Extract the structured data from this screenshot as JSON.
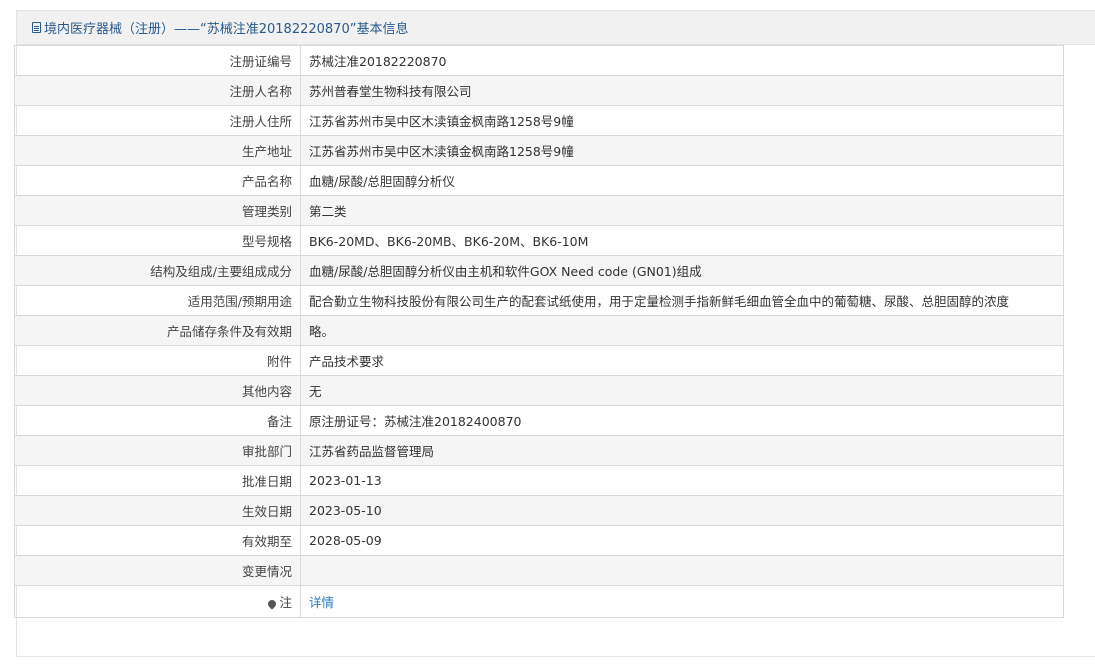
{
  "header": {
    "title": "境内医疗器械（注册）——“苏械注准20182220870”基本信息"
  },
  "rows": [
    {
      "label": "注册证编号",
      "value": "苏械注准20182220870"
    },
    {
      "label": "注册人名称",
      "value": "苏州普春堂生物科技有限公司"
    },
    {
      "label": "注册人住所",
      "value": "江苏省苏州市吴中区木渎镇金枫南路1258号9幢"
    },
    {
      "label": "生产地址",
      "value": "江苏省苏州市吴中区木渎镇金枫南路1258号9幢"
    },
    {
      "label": "产品名称",
      "value": "血糖/尿酸/总胆固醇分析仪"
    },
    {
      "label": "管理类别",
      "value": "第二类"
    },
    {
      "label": "型号规格",
      "value": "BK6-20MD、BK6-20MB、BK6-20M、BK6-10M"
    },
    {
      "label": "结构及组成/主要组成成分",
      "value": "血糖/尿酸/总胆固醇分析仪由主机和软件GOX Need code (GN01)组成"
    },
    {
      "label": "适用范围/预期用途",
      "value": "配合勤立生物科技股份有限公司生产的配套试纸使用，用于定量检测手指新鲜毛细血管全血中的葡萄糖、尿酸、总胆固醇的浓度"
    },
    {
      "label": "产品储存条件及有效期",
      "value": "略。"
    },
    {
      "label": "附件",
      "value": "产品技术要求"
    },
    {
      "label": "其他内容",
      "value": "无"
    },
    {
      "label": "备注",
      "value": "原注册证号：苏械注准20182400870"
    },
    {
      "label": "审批部门",
      "value": "江苏省药品监督管理局"
    },
    {
      "label": "批准日期",
      "value": "2023-01-13"
    },
    {
      "label": "生效日期",
      "value": "2023-05-10"
    },
    {
      "label": "有效期至",
      "value": "2028-05-09"
    },
    {
      "label": "变更情况",
      "value": ""
    }
  ],
  "note_row": {
    "label": "注",
    "link": "详情",
    "icon": "note-pin-icon"
  }
}
